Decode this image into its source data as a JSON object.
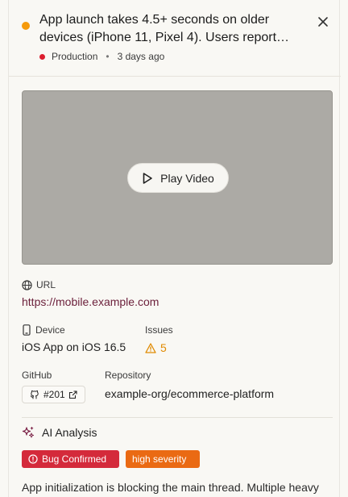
{
  "header": {
    "title_line1": "App launch takes 4.5+ seconds on older",
    "title_line2": "devices (iPhone 11, Pixel 4). Users report…",
    "environment": "Production",
    "separator": "•",
    "time_ago": "3 days ago",
    "status_color": "#f59a0b",
    "environment_color": "#dc1d2e"
  },
  "video": {
    "play_label": "Play Video"
  },
  "details": {
    "url_label": "URL",
    "url_value": "https://mobile.example.com",
    "device_label": "Device",
    "device_value": "iOS App on iOS 16.5",
    "issues_label": "Issues",
    "issues_value": "5",
    "github_label": "GitHub",
    "pr_number": "#201",
    "repository_label": "Repository",
    "repository_value": "example-org/ecommerce-platform"
  },
  "ai_analysis": {
    "title": "AI Analysis",
    "bug_badge": "Bug Confirmed",
    "severity_badge": "high severity",
    "text": "App initialization is blocking the main thread. Multiple heavy"
  }
}
